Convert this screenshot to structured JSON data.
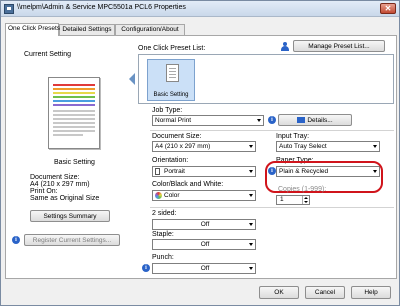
{
  "window": {
    "title": "\\\\melpm\\Admin & Service MPC5501a PCL6 Properties",
    "close_glyph": "✕"
  },
  "tabs": [
    {
      "label": "One Click Presets",
      "active": true
    },
    {
      "label": "Detailed Settings",
      "active": false
    },
    {
      "label": "Configuration/About",
      "active": false
    }
  ],
  "left": {
    "current_setting_label": "Current Setting",
    "preset_name": "Basic Setting",
    "summary": [
      "Document Size:",
      "A4 (210 x 297 mm)",
      "Print On:",
      "Same as Original Size"
    ],
    "settings_summary_button": "Settings Summary",
    "register_button": "Register Current Settings..."
  },
  "presets": {
    "list_label": "One Click Preset List:",
    "manage_button": "Manage Preset List...",
    "tile_label": "Basic Setting"
  },
  "job_type": {
    "label": "Job Type:",
    "value": "Normal Print",
    "details_button": "Details..."
  },
  "document_size": {
    "label": "Document Size:",
    "value": "A4 (210 x 297 mm)"
  },
  "input_tray": {
    "label": "Input Tray:",
    "value": "Auto Tray Select"
  },
  "orientation": {
    "label": "Orientation:",
    "value": "Portrait"
  },
  "paper_type": {
    "label": "Paper Type:",
    "value": "Plain & Recycled"
  },
  "color": {
    "label": "Color/Black and White:",
    "value": "Color"
  },
  "copies": {
    "label": "Copies (1-999):",
    "value": "1"
  },
  "two_sided": {
    "label": "2 sided:",
    "value": "Off"
  },
  "staple": {
    "label": "Staple:",
    "value": "Off"
  },
  "punch": {
    "label": "Punch:",
    "value": "Off"
  },
  "footer": {
    "ok": "OK",
    "cancel": "Cancel",
    "help": "Help"
  },
  "colors": {
    "highlight": "#d0141b",
    "accent": "#2a63c8"
  }
}
